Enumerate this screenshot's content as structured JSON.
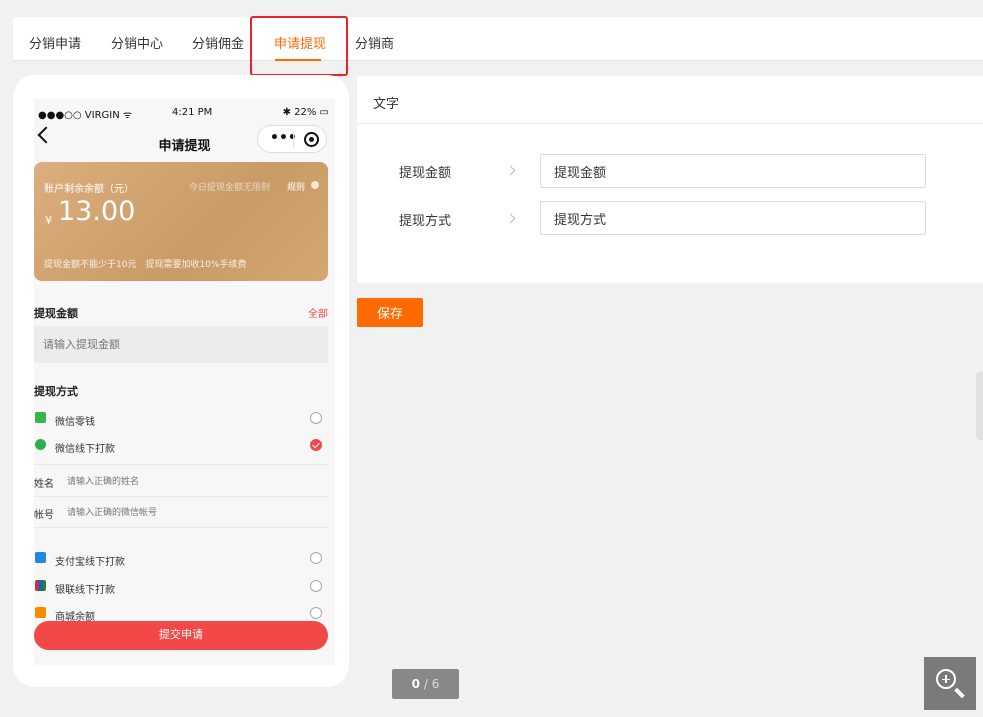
{
  "tabs": [
    {
      "label": "分销申请",
      "active": false
    },
    {
      "label": "分销中心",
      "active": false
    },
    {
      "label": "分销佣金",
      "active": false
    },
    {
      "label": "申请提现",
      "active": true
    },
    {
      "label": "分销商",
      "active": false
    }
  ],
  "colors": {
    "accent": "#ff6a00",
    "highlight": "#e8232a",
    "submit": "#f24848",
    "card": "#d4a772"
  },
  "phone": {
    "status": {
      "carrier": "●●●○○ VIRGIN ᯤ",
      "time": "4:21 PM",
      "battery": "✱ 22% ▭"
    },
    "nav_title": "申请提现",
    "card": {
      "label": "账户剩余余额（元）",
      "limit": "今日提现金额无限制",
      "rule": "规则",
      "currency": "¥",
      "amount": "13.00",
      "tips": "提现金额不能少于10元　提现需要加收10%手续费"
    },
    "amount_section": {
      "title": "提现金额",
      "all": "全部",
      "placeholder": "请输入提现金额"
    },
    "method_section": {
      "title": "提现方式",
      "methods": [
        {
          "label": "微信零钱",
          "icon": "wechat-icon",
          "checked": false
        },
        {
          "label": "微信线下打款",
          "icon": "wechat-offline-icon",
          "checked": true
        },
        {
          "label": "支付宝线下打款",
          "icon": "alipay-icon",
          "checked": false
        },
        {
          "label": "银联线下打款",
          "icon": "unionpay-icon",
          "checked": false
        },
        {
          "label": "商城余额",
          "icon": "balance-icon",
          "checked": false
        }
      ],
      "name_field": {
        "label": "姓名",
        "placeholder": "请输入正确的姓名"
      },
      "account_field": {
        "label": "帐号",
        "placeholder": "请输入正确的微信帐号"
      }
    },
    "submit": "提交申请"
  },
  "panel": {
    "title": "文字",
    "fields": [
      {
        "label": "提现金额",
        "value": "提现金额"
      },
      {
        "label": "提现方式",
        "value": "提现方式"
      }
    ],
    "save": "保存"
  },
  "pager": {
    "current": "0",
    "separator": " / ",
    "total": "6"
  }
}
